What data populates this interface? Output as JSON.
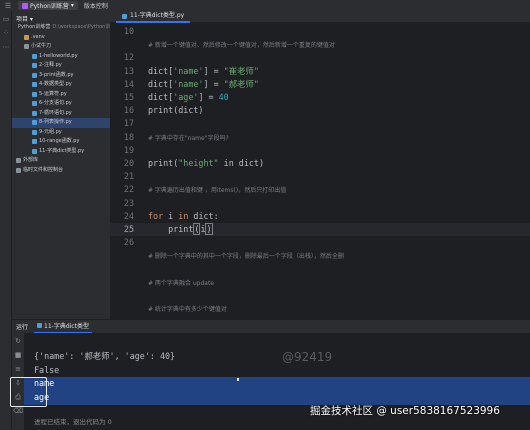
{
  "titlebar": {
    "project_badge": "P",
    "project_name": "Python训练营",
    "vcs": "版本控制",
    "chevron": "▾"
  },
  "icons": {
    "menu": "hamburger-icon",
    "folder": "folder-icon",
    "python_file": "python-file-icon",
    "run": "run-icon",
    "terminal": "terminal-icon"
  },
  "project": {
    "header": "项目 ▾",
    "tree": [
      {
        "label": "Python训练营",
        "extra": "D:\\workspace\\Python训练营",
        "indent": 0,
        "kind": "folder"
      },
      {
        "label": ".venv",
        "extra": "",
        "indent": 1,
        "kind": "venv"
      },
      {
        "label": "小试牛刀",
        "extra": "",
        "indent": 1,
        "kind": "folder"
      },
      {
        "label": "1-helloworld.py",
        "extra": "",
        "indent": 2,
        "kind": "py"
      },
      {
        "label": "2-注释.py",
        "extra": "",
        "indent": 2,
        "kind": "py"
      },
      {
        "label": "3-print函数.py",
        "extra": "",
        "indent": 2,
        "kind": "py"
      },
      {
        "label": "4-数据类型.py",
        "extra": "",
        "indent": 2,
        "kind": "py"
      },
      {
        "label": "5-运算符.py",
        "extra": "",
        "indent": 2,
        "kind": "py"
      },
      {
        "label": "6-分支语句.py",
        "extra": "",
        "indent": 2,
        "kind": "py"
      },
      {
        "label": "7-循环语句.py",
        "extra": "",
        "indent": 2,
        "kind": "py"
      },
      {
        "label": "8-列表操作.py",
        "extra": "",
        "indent": 2,
        "kind": "py",
        "selected": true
      },
      {
        "label": "9-元组.py",
        "extra": "",
        "indent": 2,
        "kind": "py"
      },
      {
        "label": "10-range函数.py",
        "extra": "",
        "indent": 2,
        "kind": "py"
      },
      {
        "label": "11-字典dict类型.py",
        "extra": "",
        "indent": 2,
        "kind": "py"
      },
      {
        "label": "外部库",
        "extra": "",
        "indent": 0,
        "kind": "folder"
      },
      {
        "label": "临时文件和控制台",
        "extra": "",
        "indent": 0,
        "kind": "folder"
      }
    ]
  },
  "editor": {
    "tab_label": "11-字典dict类型.py",
    "lines": [
      {
        "n": "10",
        "tokens": [
          {
            "t": "",
            "c": "var"
          }
        ]
      },
      {
        "n": "",
        "tokens": [
          {
            "t": "# 新增一个键值对、然后修改一个键值对，然后新增一个重复的键值对",
            "c": "com"
          }
        ]
      },
      {
        "n": "12",
        "tokens": [
          {
            "t": "",
            "c": "var"
          }
        ]
      },
      {
        "n": "13",
        "tokens": [
          {
            "t": "dict[",
            "c": "var"
          },
          {
            "t": "'name'",
            "c": "str"
          },
          {
            "t": "] = ",
            "c": "var"
          },
          {
            "t": "\"崔老师\"",
            "c": "str"
          }
        ]
      },
      {
        "n": "14",
        "tokens": [
          {
            "t": "dict[",
            "c": "var"
          },
          {
            "t": "'name'",
            "c": "str"
          },
          {
            "t": "] = ",
            "c": "var"
          },
          {
            "t": "\"郝老师\"",
            "c": "str"
          }
        ]
      },
      {
        "n": "15",
        "tokens": [
          {
            "t": "dict[",
            "c": "var"
          },
          {
            "t": "'age'",
            "c": "str"
          },
          {
            "t": "] = ",
            "c": "var"
          },
          {
            "t": "40",
            "c": "num"
          }
        ]
      },
      {
        "n": "16",
        "tokens": [
          {
            "t": "print(dict)",
            "c": "fn"
          }
        ]
      },
      {
        "n": "17",
        "tokens": [
          {
            "t": "",
            "c": "var"
          }
        ]
      },
      {
        "n": "18",
        "tokens": [
          {
            "t": "# 字典中存在\"name\"字段吗?",
            "c": "com"
          }
        ]
      },
      {
        "n": "19",
        "tokens": [
          {
            "t": "",
            "c": "var"
          }
        ]
      },
      {
        "n": "20",
        "tokens": [
          {
            "t": "print(",
            "c": "fn"
          },
          {
            "t": "\"height\"",
            "c": "str"
          },
          {
            "t": " in dict)",
            "c": "kwin"
          }
        ]
      },
      {
        "n": "21",
        "tokens": [
          {
            "t": "",
            "c": "var"
          }
        ]
      },
      {
        "n": "22",
        "tokens": [
          {
            "t": "# 字典遍历出值和键 ，用items()，然后只打印出值",
            "c": "com"
          }
        ]
      },
      {
        "n": "23",
        "tokens": [
          {
            "t": "",
            "c": "var"
          }
        ]
      },
      {
        "n": "24",
        "tokens": [
          {
            "t": "for",
            "c": "kw"
          },
          {
            "t": " i ",
            "c": "var"
          },
          {
            "t": "in",
            "c": "kw"
          },
          {
            "t": " dict:",
            "c": "var"
          }
        ]
      },
      {
        "n": "25",
        "tokens": [
          {
            "t": "    print",
            "c": "fn"
          },
          {
            "t": "(",
            "c": "bracket"
          },
          {
            "t": "i",
            "c": "var"
          },
          {
            "t": ")",
            "c": "bracket"
          }
        ],
        "current": true
      },
      {
        "n": "26",
        "tokens": [
          {
            "t": "",
            "c": "var"
          }
        ]
      },
      {
        "n": "",
        "tokens": [
          {
            "t": "# 删除一个字典中的其中一个字段，删除最后一个字段（出栈），然后全删",
            "c": "com"
          }
        ]
      },
      {
        "n": "",
        "tokens": [
          {
            "t": "",
            "c": "var"
          }
        ]
      },
      {
        "n": "",
        "tokens": [
          {
            "t": "# 两个字典融合 update",
            "c": "com"
          }
        ]
      },
      {
        "n": "",
        "tokens": [
          {
            "t": "",
            "c": "var"
          }
        ]
      },
      {
        "n": "",
        "tokens": [
          {
            "t": "# 统计字典中有多少个键值对",
            "c": "com"
          }
        ]
      }
    ]
  },
  "run": {
    "title": "运行",
    "tab_label": "11-字典dict类型",
    "output": [
      "{'name': '郝老师', 'age': 40}",
      "False",
      "name",
      "age"
    ],
    "finish_text": "进程已结束，退出代码为 0"
  },
  "watermarks": {
    "center": "@92419",
    "footer": "掘金技术社区 @ user5838167523996"
  }
}
